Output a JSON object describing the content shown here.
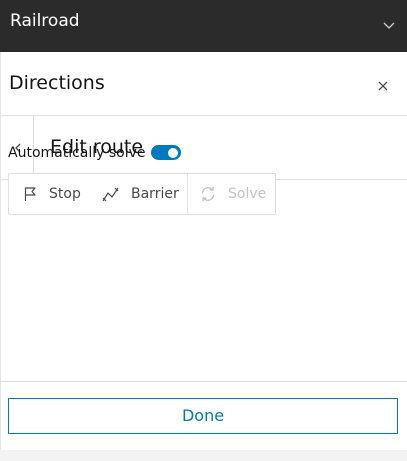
{
  "topbar": {
    "title": "Railroad"
  },
  "panel": {
    "title": "Directions",
    "subtitle": "Edit route"
  },
  "auto_solve": {
    "label": "Automatically solve",
    "enabled": true
  },
  "toolbar": {
    "stop_label": "Stop",
    "barrier_label": "Barrier",
    "solve_label": "Solve"
  },
  "footer": {
    "done_label": "Done"
  },
  "colors": {
    "accent": "#0079c1",
    "topbar_bg": "#2b2b2b",
    "disabled_text": "#c4c4c4"
  }
}
